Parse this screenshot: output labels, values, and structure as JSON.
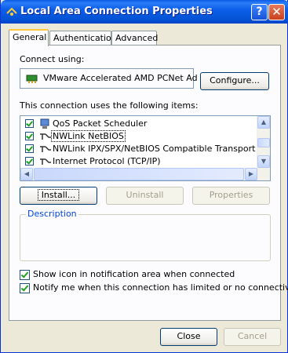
{
  "window": {
    "title": "Local Area Connection Properties",
    "help_glyph": "?",
    "close_glyph": "✕"
  },
  "tabs": [
    {
      "label": "General"
    },
    {
      "label": "Authentication"
    },
    {
      "label": "Advanced"
    }
  ],
  "general": {
    "connect_using_label": "Connect using:",
    "adapter_name": "VMware Accelerated AMD PCNet Ad",
    "configure_label": "Configure...",
    "items_label": "This connection uses the following items:",
    "items": [
      {
        "label": "QoS Packet Scheduler",
        "checked": true,
        "icon": "scheduler-icon"
      },
      {
        "label": "NWLink NetBIOS",
        "checked": true,
        "icon": "protocol-icon"
      },
      {
        "label": "NWLink IPX/SPX/NetBIOS Compatible Transport Prot",
        "checked": true,
        "icon": "protocol-icon"
      },
      {
        "label": "Internet Protocol (TCP/IP)",
        "checked": true,
        "icon": "protocol-icon"
      }
    ],
    "install_label": "Install...",
    "uninstall_label": "Uninstall",
    "properties_label": "Properties",
    "description_label": "Description",
    "show_icon_label": "Show icon in notification area when connected",
    "notify_label": "Notify me when this connection has limited or no connectivity"
  },
  "footer": {
    "close_label": "Close",
    "cancel_label": "Cancel"
  },
  "colors": {
    "titlebar": "#0554d6",
    "accent_tab": "#ffc83c",
    "check": "#21a121"
  }
}
